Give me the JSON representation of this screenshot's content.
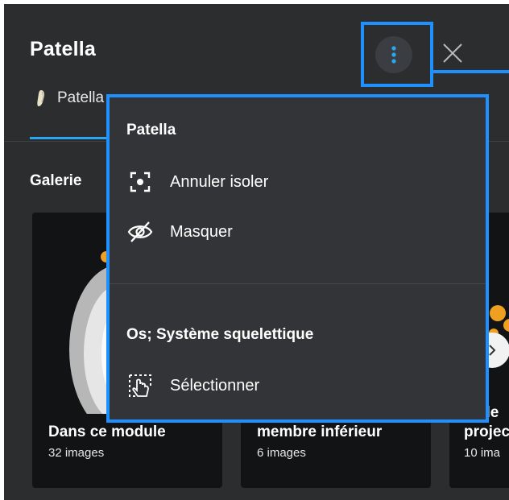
{
  "header": {
    "title": "Patella",
    "subtitle": "Patella"
  },
  "gallery": {
    "title": "Galerie",
    "cards": [
      {
        "title": "Dans ce module",
        "count": "32 images"
      },
      {
        "title": "membre inférieur",
        "count": "6 images"
      },
      {
        "title_line1": "sible",
        "title": "projec",
        "count": "10 ima"
      }
    ]
  },
  "menu": {
    "header": "Patella",
    "items": [
      {
        "label": "Annuler isoler",
        "icon": "isolate-focus-icon"
      },
      {
        "label": "Masquer",
        "icon": "eye-slash-icon"
      }
    ],
    "section_title": "Os; Système squelettique",
    "section_items": [
      {
        "label": "Sélectionner",
        "icon": "select-pointer-icon"
      }
    ]
  },
  "colors": {
    "panel_bg": "#2b2d2f",
    "menu_bg": "#323437",
    "accent": "#2aa7f0",
    "highlight": "#1e90ff"
  }
}
